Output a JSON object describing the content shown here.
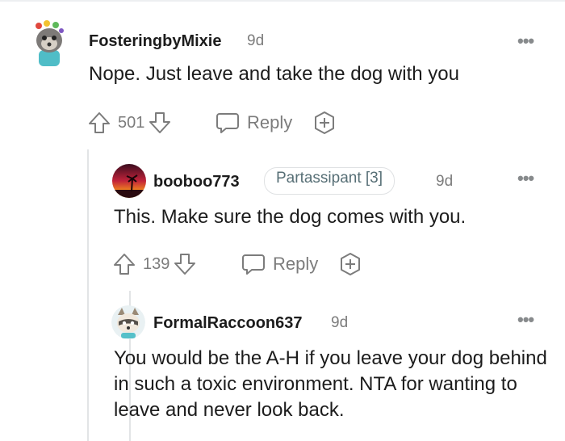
{
  "comments": [
    {
      "author": "FosteringbyMixie",
      "time": "9d",
      "body": "Nope. Just leave and take the dog with you",
      "votes": "501",
      "reply_label": "Reply",
      "more": "•••"
    },
    {
      "author": "booboo773",
      "flair": "Partassipant [3]",
      "time": "9d",
      "body": "This. Make sure the dog comes with you.",
      "votes": "139",
      "reply_label": "Reply",
      "more": "•••"
    },
    {
      "author": "FormalRaccoon637",
      "time": "9d",
      "body": "You would be the A-H if you leave your dog behind in such a toxic environment. NTA for wanting to leave and never look back.",
      "more": "•••"
    }
  ],
  "colors": {
    "text": "#1c1c1c",
    "muted": "#7c7c7c",
    "thread_line": "#e2e4e6"
  },
  "icons": [
    "upvote-icon",
    "downvote-icon",
    "reply-bubble-icon",
    "award-plus-icon",
    "more-options-icon"
  ]
}
